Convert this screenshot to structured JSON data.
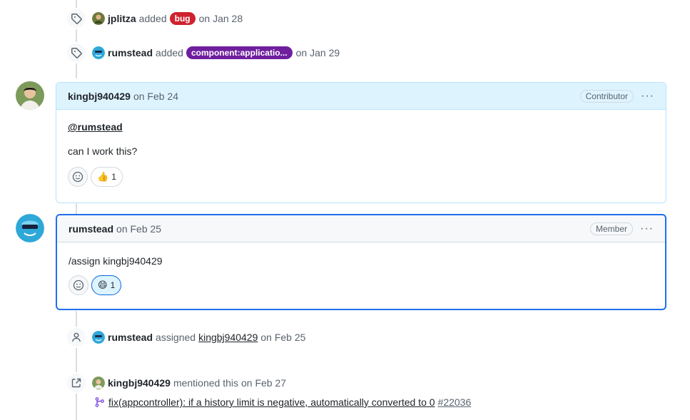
{
  "events": [
    {
      "user": "jplitza",
      "verb": "added",
      "label": "bug",
      "label_color": "#cf222e",
      "date": "on Jan 28"
    },
    {
      "user": "rumstead",
      "verb": "added",
      "label": "component:applicatio...",
      "label_color": "#6f1f9e",
      "date": "on Jan 29"
    }
  ],
  "comments": [
    {
      "author": "kingbj940429",
      "date": "on Feb 24",
      "role": "Contributor",
      "mention": "@rumstead",
      "body": "can I work this?",
      "reaction_emoji": "👍",
      "reaction_count": "1"
    },
    {
      "author": "rumstead",
      "date": "on Feb 25",
      "role": "Member",
      "body": "/assign kingbj940429",
      "reaction_emoji": "😄",
      "reaction_count": "1"
    }
  ],
  "assign_event": {
    "user": "rumstead",
    "verb": "assigned",
    "target": "kingbj940429",
    "date": "on Feb 25"
  },
  "mention_event": {
    "user": "kingbj940429",
    "verb": "mentioned this",
    "date": "on Feb 27"
  },
  "linked_pr": {
    "title": "fix(appcontroller): if a history limit is negative, automatically converted to 0",
    "number": "#22036"
  },
  "colors": {
    "accent": "#1f6feb",
    "highlight_bg": "#ddf4ff",
    "pr_icon": "#8250df"
  }
}
